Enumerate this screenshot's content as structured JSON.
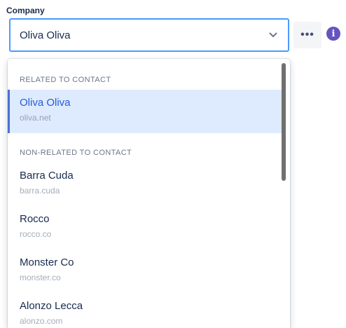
{
  "field": {
    "label": "Company",
    "selected_value": "Oliva Oliva"
  },
  "actions": {
    "more_label": "•••",
    "info_symbol": "i"
  },
  "dropdown": {
    "groups": [
      {
        "heading": "RELATED TO CONTACT",
        "options": [
          {
            "name": "Oliva Oliva",
            "domain": "oliva.net",
            "selected": true
          }
        ]
      },
      {
        "heading": "NON-RELATED TO CONTACT",
        "options": [
          {
            "name": "Barra Cuda",
            "domain": "barra.cuda"
          },
          {
            "name": "Rocco",
            "domain": "rocco.co"
          },
          {
            "name": "Monster Co",
            "domain": "monster.co"
          },
          {
            "name": "Alonzo Lecca",
            "domain": "alonzo.com"
          }
        ]
      }
    ]
  },
  "colors": {
    "focus_border": "#4c9aff",
    "selected_bg": "#deebff",
    "selected_text": "#2859d4",
    "info_icon_bg": "#6554c0"
  },
  "icons": {
    "chevron": "chevron-down-icon",
    "more": "more-horizontal-icon",
    "info": "info-icon"
  }
}
